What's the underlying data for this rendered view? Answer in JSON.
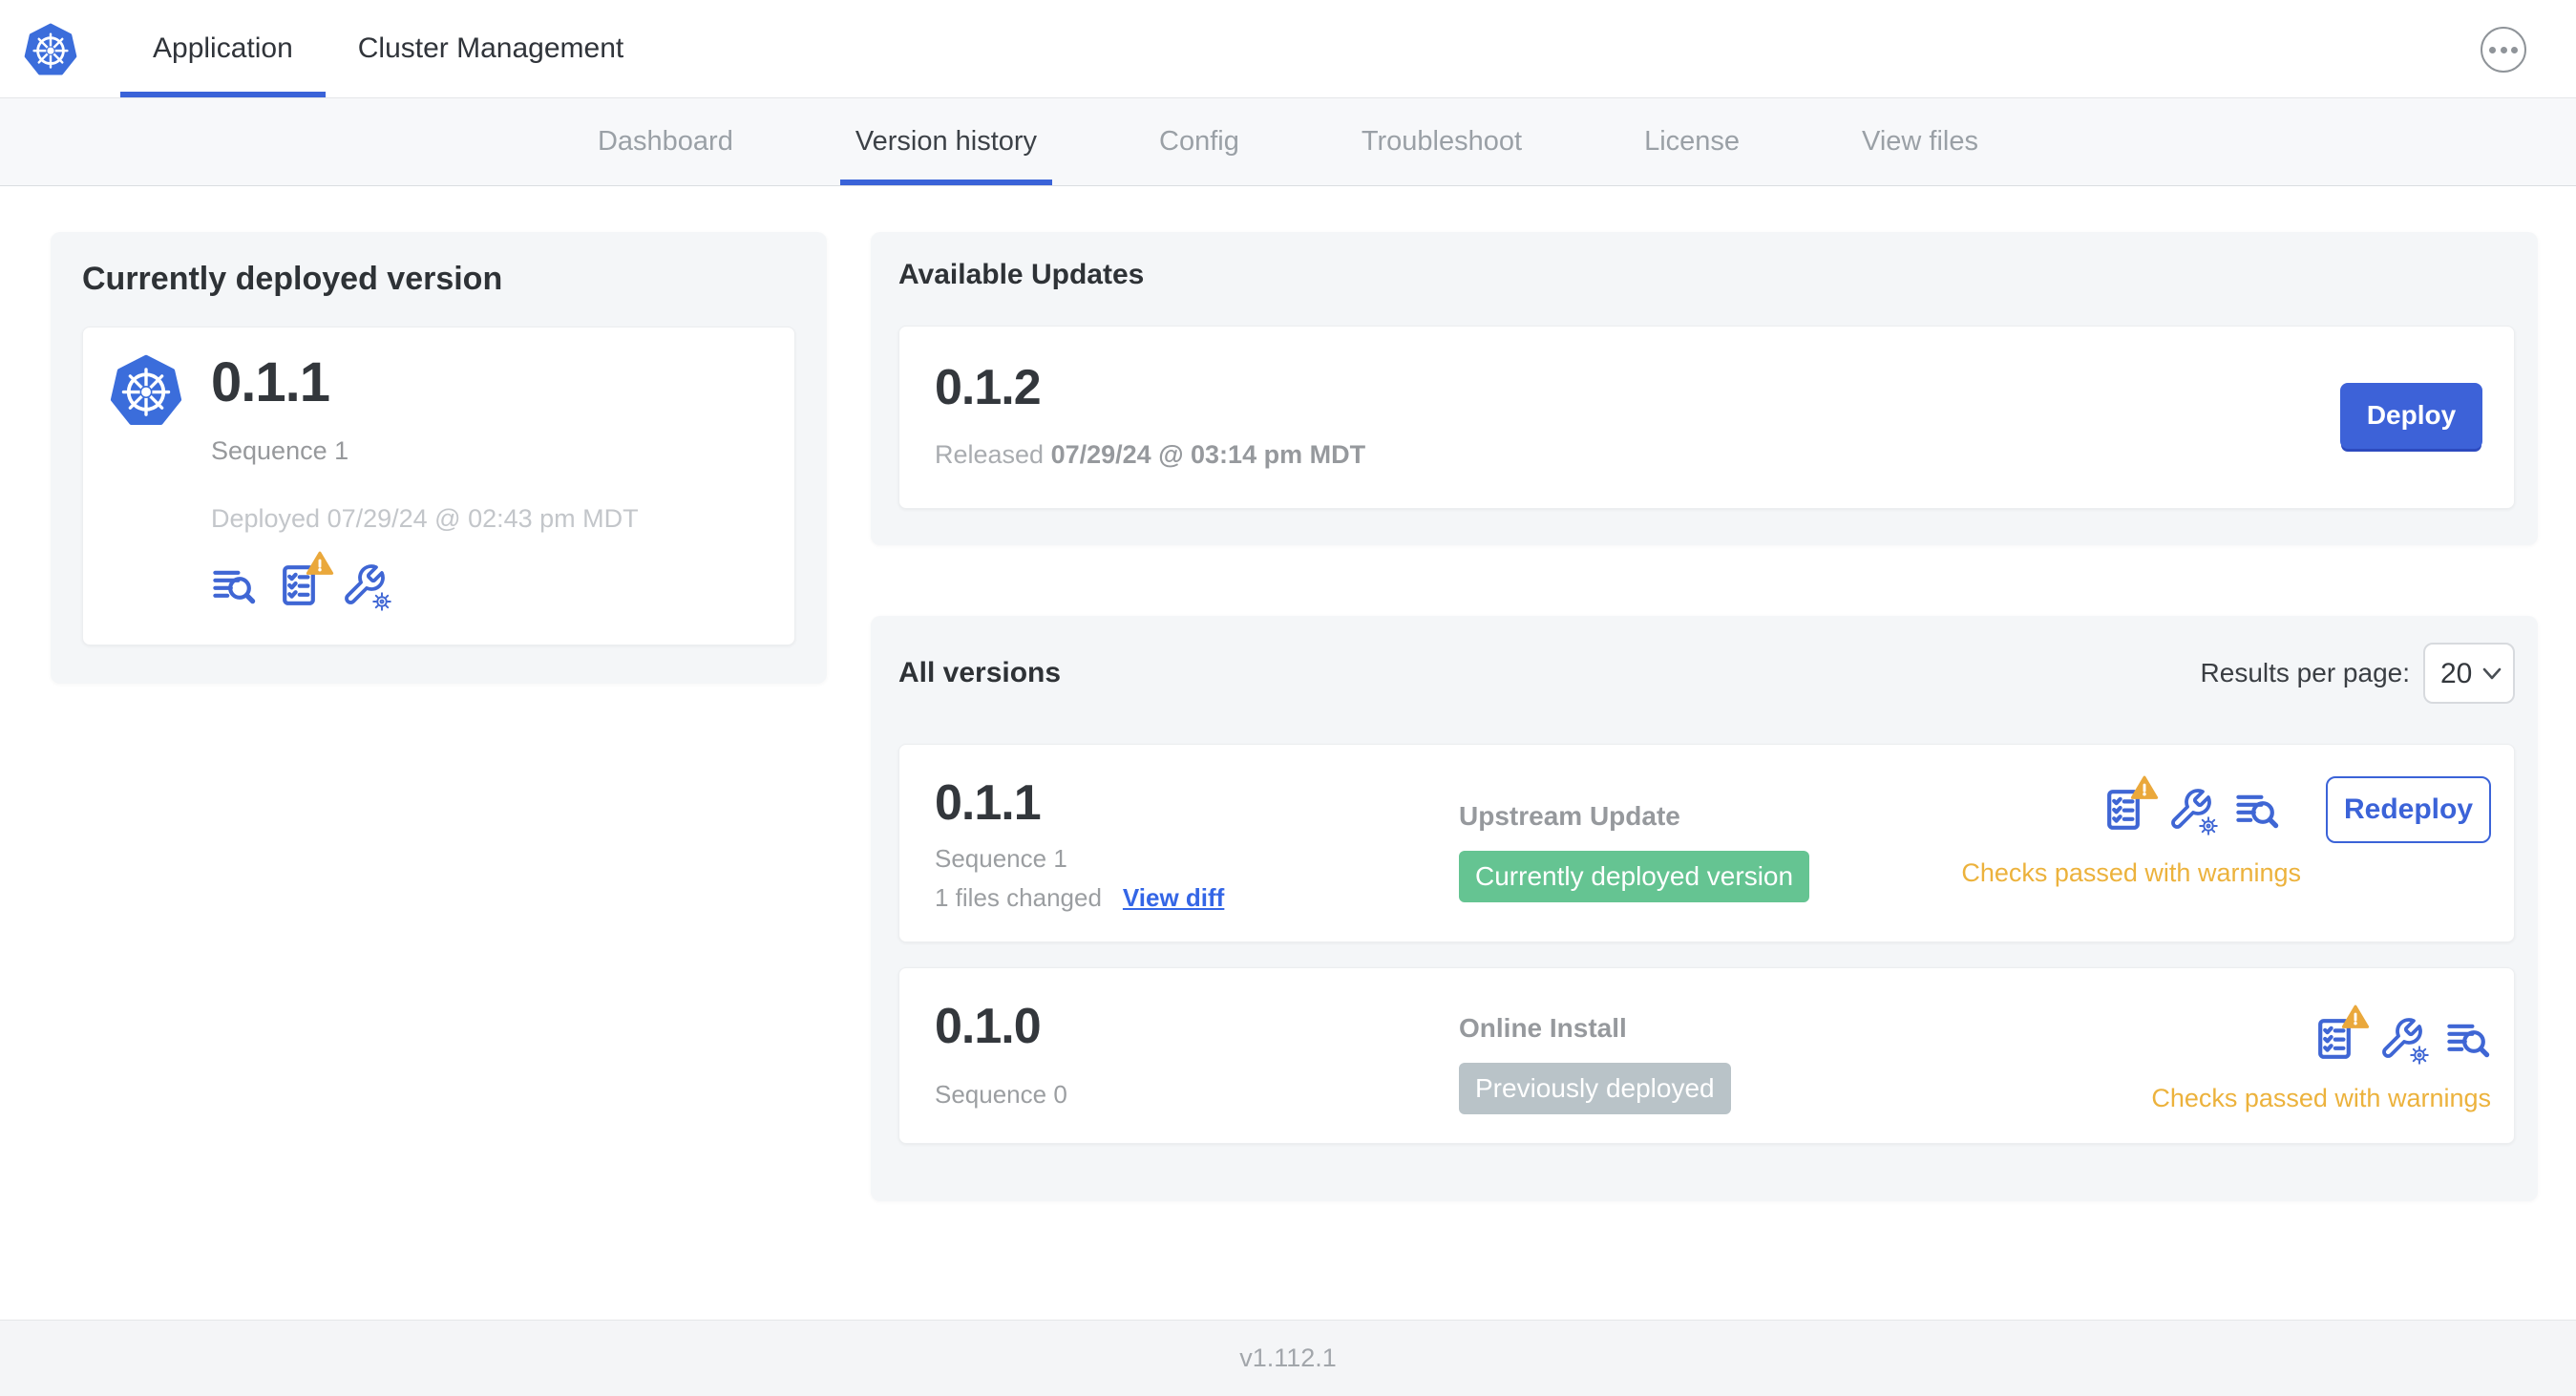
{
  "header": {
    "tabs": [
      {
        "label": "Application",
        "active": true
      },
      {
        "label": "Cluster Management",
        "active": false
      }
    ]
  },
  "subnav": {
    "tabs": [
      {
        "label": "Dashboard",
        "active": false
      },
      {
        "label": "Version history",
        "active": true
      },
      {
        "label": "Config",
        "active": false
      },
      {
        "label": "Troubleshoot",
        "active": false
      },
      {
        "label": "License",
        "active": false
      },
      {
        "label": "View files",
        "active": false
      }
    ]
  },
  "currently_deployed": {
    "title": "Currently deployed version",
    "version": "0.1.1",
    "sequence": "Sequence 1",
    "deployed_at": "Deployed 07/29/24 @ 02:43 pm MDT",
    "icons": [
      "deploy-logs-icon",
      "preflight-checks-warning-icon",
      "config-icon"
    ]
  },
  "available_updates": {
    "title": "Available Updates",
    "version": "0.1.2",
    "released_prefix": "Released",
    "released_at": "07/29/24 @ 03:14 pm MDT",
    "deploy_label": "Deploy"
  },
  "all_versions": {
    "title": "All versions",
    "results_per_page_label": "Results per page:",
    "results_per_page_value": "20",
    "rows": [
      {
        "version": "0.1.1",
        "sequence": "Sequence 1",
        "files_changed": "1 files changed",
        "view_diff_label": "View diff",
        "source": "Upstream Update",
        "badge_label": "Currently deployed version",
        "badge_color": "#65c492",
        "checks_text": "Checks passed with warnings",
        "action_label": "Redeploy",
        "icons": [
          "preflight-checks-warning-icon",
          "config-icon",
          "deploy-logs-icon"
        ]
      },
      {
        "version": "0.1.0",
        "sequence": "Sequence 0",
        "source": "Online Install",
        "badge_label": "Previously deployed",
        "badge_color": "#b9c3c8",
        "checks_text": "Checks passed with warnings",
        "icons": [
          "preflight-checks-warning-icon",
          "config-icon",
          "deploy-logs-icon"
        ]
      }
    ]
  },
  "footer": {
    "version": "v1.112.1"
  },
  "colors": {
    "accent_blue": "#3a63d8",
    "icon_blue": "#3f66d4",
    "warning_amber": "#ecb23c",
    "triangle_amber": "#eaa83b",
    "badge_green": "#65c492",
    "badge_gray": "#b9c3c8",
    "panel_gray": "#f4f6f8"
  }
}
